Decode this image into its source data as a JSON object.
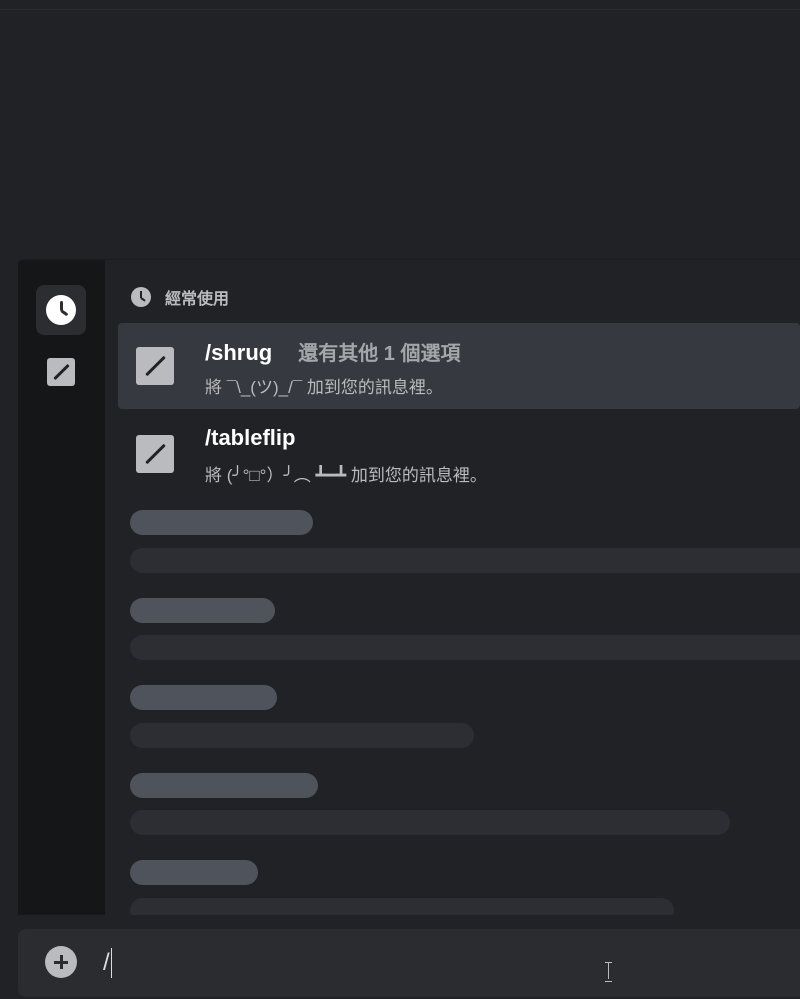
{
  "autocomplete": {
    "rail": {
      "frequent_icon": "clock-icon",
      "builtin_icon": "slash-command-icon"
    },
    "section": {
      "label": "經常使用",
      "icon": "clock-icon"
    },
    "commands": [
      {
        "name": "/shrug",
        "more_options": "還有其他 1 個選項",
        "description": "將 ¯\\_(ツ)_/¯ 加到您的訊息裡。",
        "selected": true
      },
      {
        "name": "/tableflip",
        "more_options": "",
        "description": "將 (╯°□°）╯︵ ┻━┻ 加到您的訊息裡。",
        "selected": false
      }
    ],
    "loading_placeholders": 5
  },
  "input": {
    "value": "/",
    "attach_icon": "plus-circle-icon"
  },
  "colors": {
    "background": "#202225",
    "rail": "#151618",
    "selected_row": "#36393f",
    "skeleton_title": "#4f545c",
    "skeleton_body": "#2c2e33",
    "text_primary": "#ffffff",
    "text_muted": "#b9bbbe"
  }
}
